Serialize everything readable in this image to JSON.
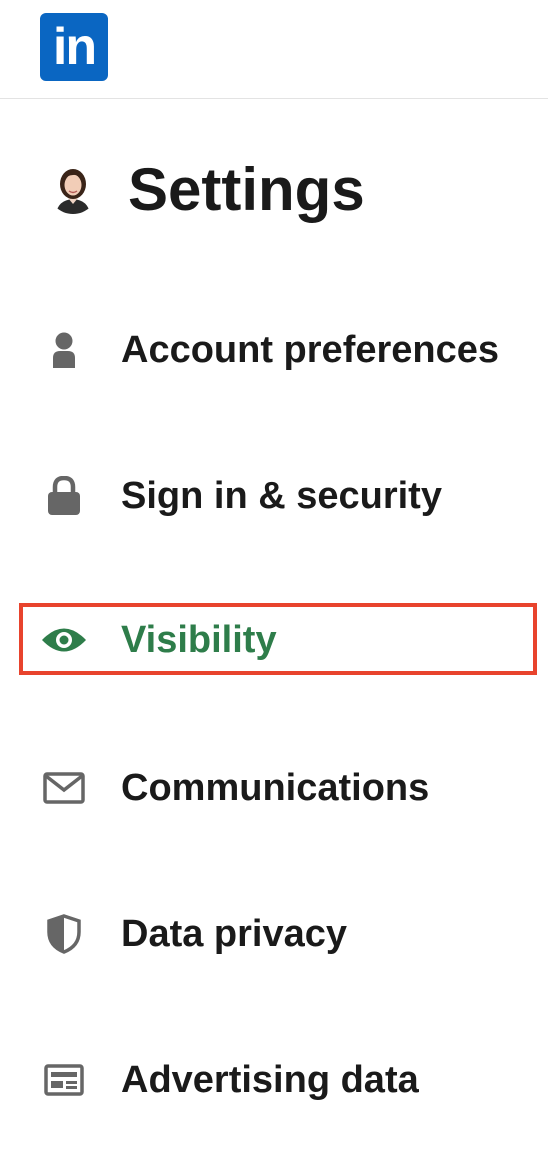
{
  "app": {
    "logo_text": "in",
    "brand_color": "#0a66c2"
  },
  "header": {
    "title": "Settings",
    "avatar_icon": "user-photo"
  },
  "nav": {
    "items": [
      {
        "label": "Account preferences",
        "icon": "person-icon",
        "active": false
      },
      {
        "label": "Sign in & security",
        "icon": "lock-icon",
        "active": false
      },
      {
        "label": "Visibility",
        "icon": "eye-icon",
        "active": true
      },
      {
        "label": "Communications",
        "icon": "envelope-icon",
        "active": false
      },
      {
        "label": "Data privacy",
        "icon": "shield-icon",
        "active": false
      },
      {
        "label": "Advertising data",
        "icon": "ad-card-icon",
        "active": false
      }
    ]
  },
  "colors": {
    "active_text": "#2e7d4a",
    "icon_gray": "#666666",
    "highlight": "#e8432d"
  }
}
